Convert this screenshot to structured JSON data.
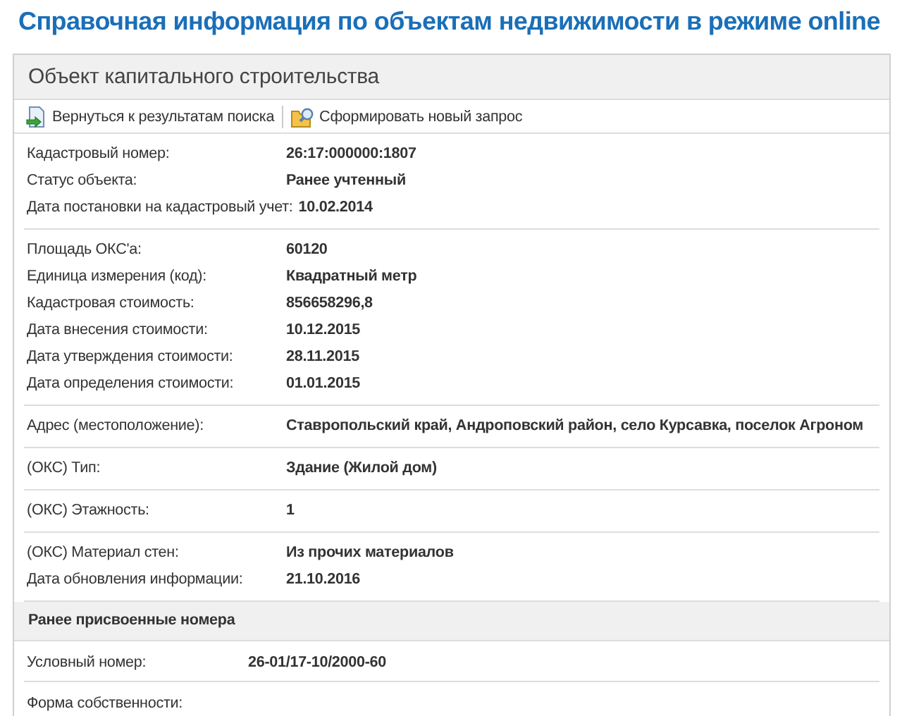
{
  "page_title": "Справочная информация по объектам недвижимости в режиме online",
  "panel": {
    "heading": "Объект капитального строительства",
    "toolbar": [
      {
        "label": "Вернуться к результатам поиска",
        "kind": "back"
      },
      {
        "label": "Сформировать новый запрос",
        "kind": "search"
      }
    ],
    "groups": [
      {
        "rows": [
          {
            "label": "Кадастровый номер:",
            "value": "26:17:000000:1807"
          },
          {
            "label": "Статус объекта:",
            "value": "Ранее учтенный"
          },
          {
            "label": "Дата постановки на кадастровый учет:",
            "value": "10.02.2014"
          }
        ]
      },
      {
        "rows": [
          {
            "label": "Площадь ОКС'а:",
            "value": "60120"
          },
          {
            "label": "Единица измерения (код):",
            "value": "Квадратный метр"
          },
          {
            "label": "Кадастровая стоимость:",
            "value": "856658296,8"
          },
          {
            "label": "Дата внесения стоимости:",
            "value": "10.12.2015"
          },
          {
            "label": "Дата утверждения стоимости:",
            "value": "28.11.2015"
          },
          {
            "label": "Дата определения стоимости:",
            "value": "01.01.2015"
          }
        ]
      },
      {
        "rows": [
          {
            "label": "Адрес (местоположение):",
            "value": "Ставропольский край, Андроповский район, село Курсавка, поселок Агроном"
          }
        ]
      },
      {
        "rows": [
          {
            "label": "(ОКС) Тип:",
            "value": "Здание (Жилой дом)"
          }
        ]
      },
      {
        "rows": [
          {
            "label": "(ОКС) Этажность:",
            "value": "1"
          }
        ]
      },
      {
        "rows": [
          {
            "label": "(ОКС) Материал стен:",
            "value": "Из прочих материалов"
          },
          {
            "label": "Дата обновления информации:",
            "value": "21.10.2016"
          }
        ]
      }
    ],
    "section": {
      "heading": "Ранее присвоенные номера",
      "groups": [
        {
          "rows": [
            {
              "label": "Условный номер:",
              "value": "26-01/17-10/2000-60"
            }
          ]
        },
        {
          "rows": [
            {
              "label": "Форма собственности:"
            }
          ]
        }
      ]
    }
  }
}
